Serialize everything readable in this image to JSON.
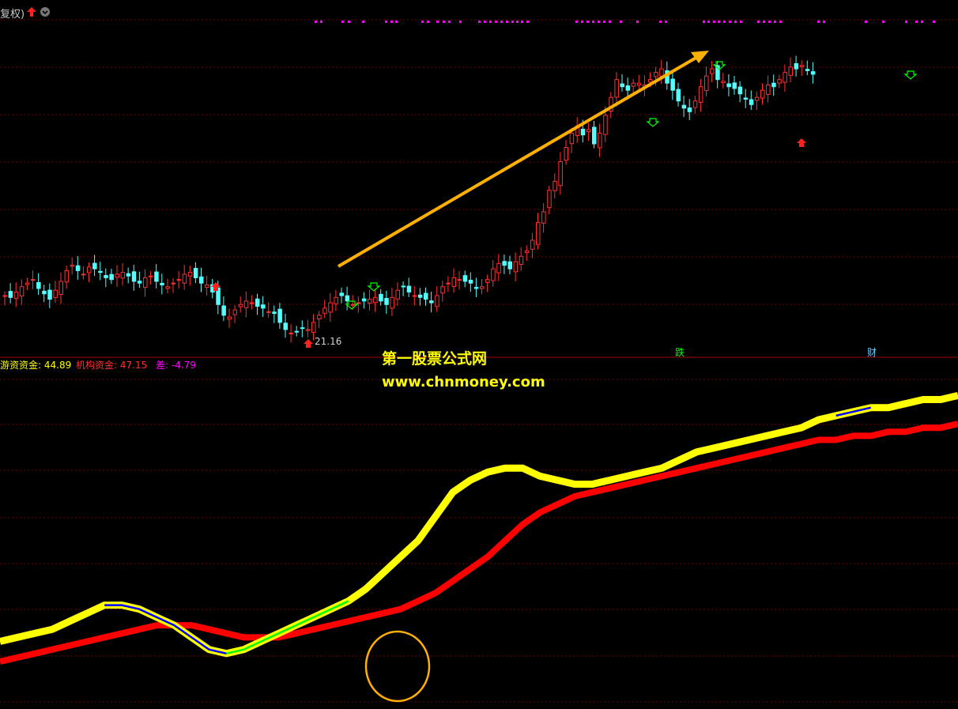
{
  "header": {
    "label": "复权)"
  },
  "price_panel": {
    "low_annotation": "21.16",
    "event_labels": [
      {
        "text": "跌",
        "color": "#00ff00"
      },
      {
        "text": "财",
        "color": "#66ccff"
      }
    ]
  },
  "indicator_legend": {
    "items": [
      {
        "label": "游资资金:",
        "value": "44.89",
        "color": "#ffff00"
      },
      {
        "label": "机构资金:",
        "value": "47.15",
        "color": "#ff3030"
      },
      {
        "label": "差:",
        "value": "-4.79",
        "color": "#ff00ff"
      }
    ]
  },
  "watermark": {
    "line1": "第一股票公式网",
    "line2": "www.chnmoney.com"
  },
  "colors": {
    "up_candle": "#ff3030",
    "down_candle": "#54ffff",
    "grid": "#7a0000",
    "arrow": "#ffb000",
    "hot_money": "#ffff00",
    "institution": "#ff0000",
    "decline_segment": "#0000ff",
    "neutral_segment": "#00ff00",
    "circle": "#ffb000"
  },
  "chart_data": [
    {
      "type": "candlestick",
      "description_free": true,
      "closes": [
        22.35,
        22.3,
        22.45,
        22.6,
        22.7,
        22.8,
        22.55,
        22.4,
        22.25,
        22.5,
        22.75,
        23.05,
        23.2,
        23.05,
        22.95,
        23.15,
        23.1,
        23.0,
        22.85,
        22.8,
        22.95,
        23.0,
        22.9,
        22.75,
        22.7,
        22.85,
        22.9,
        22.75,
        22.65,
        22.6,
        22.7,
        22.8,
        22.95,
        23.0,
        22.85,
        22.7,
        22.65,
        22.45,
        22.1,
        21.8,
        21.75,
        21.95,
        22.1,
        22.2,
        22.15,
        22.05,
        22.0,
        21.9,
        21.85,
        21.6,
        21.4,
        21.3,
        21.35,
        21.45,
        21.4,
        21.6,
        21.8,
        22.0,
        22.15,
        22.3,
        22.35,
        22.2,
        22.1,
        22.15,
        22.2,
        22.25,
        22.3,
        22.2,
        22.1,
        22.3,
        22.5,
        22.6,
        22.45,
        22.35,
        22.3,
        22.25,
        22.15,
        22.35,
        22.6,
        22.7,
        22.85,
        22.8,
        22.75,
        22.7,
        22.55,
        22.6,
        22.8,
        23.1,
        23.25,
        23.2,
        23.1,
        23.3,
        23.45,
        23.6,
        23.9,
        24.4,
        24.7,
        25.3,
        25.55,
        26.1,
        26.5,
        26.9,
        27.1,
        26.85,
        27.0,
        26.6,
        26.9,
        27.4,
        27.9,
        28.4,
        28.2,
        28.1,
        28.3,
        28.3,
        28.25,
        28.4,
        28.6,
        28.7,
        28.3,
        28.1,
        27.8,
        27.6,
        27.5,
        27.8,
        28.2,
        28.5,
        28.7,
        28.4,
        28.35,
        28.2,
        28.15,
        28.0,
        27.85,
        27.7,
        27.9,
        28.1,
        28.25,
        28.2,
        28.4,
        28.6,
        28.75,
        28.7,
        28.8,
        28.65,
        28.55
      ],
      "annotations": [
        "21.16",
        "跌",
        "财"
      ]
    },
    {
      "type": "line",
      "series": [
        {
          "name": "游资资金",
          "last_value": 44.89,
          "values": [
            15,
            16,
            17,
            18,
            20,
            22,
            24,
            24,
            23,
            21,
            19,
            16,
            13,
            12,
            13,
            15,
            17,
            19,
            21,
            23,
            25,
            28,
            32,
            36,
            40,
            46,
            52,
            55,
            57,
            58,
            58,
            56,
            55,
            54,
            54,
            55,
            56,
            57,
            58,
            60,
            62,
            63,
            64,
            65,
            66,
            67,
            68,
            70,
            71,
            72,
            73,
            73,
            74,
            75,
            75,
            76
          ]
        },
        {
          "name": "机构资金",
          "last_value": 47.15,
          "values": [
            10,
            11,
            12,
            13,
            14,
            15,
            16,
            17,
            18,
            19,
            19,
            19,
            18,
            17,
            16,
            16,
            16,
            17,
            18,
            19,
            20,
            21,
            22,
            23,
            25,
            27,
            30,
            33,
            36,
            40,
            44,
            47,
            49,
            51,
            52,
            53,
            54,
            55,
            56,
            57,
            58,
            59,
            60,
            61,
            62,
            63,
            64,
            65,
            65,
            66,
            66,
            67,
            67,
            68,
            68,
            69
          ]
        }
      ],
      "difference": -4.79
    }
  ]
}
